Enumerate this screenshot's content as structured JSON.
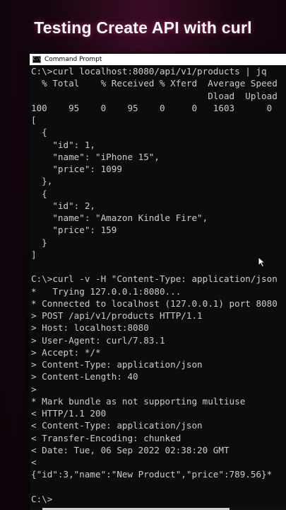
{
  "overlay_title": "Testing Create API with curl",
  "window": {
    "title": "Command Prompt"
  },
  "console_lines": [
    "C:\\>curl localhost:8080/api/v1/products | jq",
    "  % Total    % Received % Xferd  Average Speed",
    "                                 Dload  Upload",
    "100    95    0    95    0     0   1603      0",
    "[",
    "  {",
    "    \"id\": 1,",
    "    \"name\": \"iPhone 15\",",
    "    \"price\": 1099",
    "  },",
    "  {",
    "    \"id\": 2,",
    "    \"name\": \"Amazon Kindle Fire\",",
    "    \"price\": 159",
    "  }",
    "]",
    "",
    "C:\\>curl -v -H \"Content-Type: application/json",
    "*   Trying 127.0.0.1:8080...",
    "* Connected to localhost (127.0.0.1) port 8080",
    "> POST /api/v1/products HTTP/1.1",
    "> Host: localhost:8080",
    "> User-Agent: curl/7.83.1",
    "> Accept: */*",
    "> Content-Type: application/json",
    "> Content-Length: 40",
    ">",
    "* Mark bundle as not supporting multiuse",
    "< HTTP/1.1 200",
    "< Content-Type: application/json",
    "< Transfer-Encoding: chunked",
    "< Date: Tue, 06 Sep 2022 02:38:20 GMT",
    "<",
    "{\"id\":3,\"name\":\"New Product\",\"price\":789.56}*",
    "",
    "C:\\>"
  ]
}
